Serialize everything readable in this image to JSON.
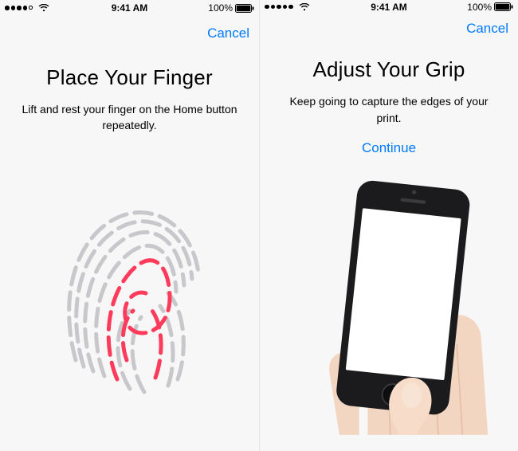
{
  "left": {
    "status": {
      "time": "9:41 AM",
      "battery": "100%"
    },
    "nav": {
      "cancel": "Cancel"
    },
    "title": "Place Your Finger",
    "subtitle": "Lift and rest your finger on the Home button repeatedly."
  },
  "right": {
    "status": {
      "time": "9:41 AM",
      "battery": "100%"
    },
    "nav": {
      "cancel": "Cancel"
    },
    "title": "Adjust Your Grip",
    "subtitle": "Keep going to capture the edges of your print.",
    "continue": "Continue"
  },
  "colors": {
    "accent": "#007aff",
    "fingerprint_highlight": "#ff3b5b",
    "fingerprint_gray": "#c7c7cc"
  }
}
